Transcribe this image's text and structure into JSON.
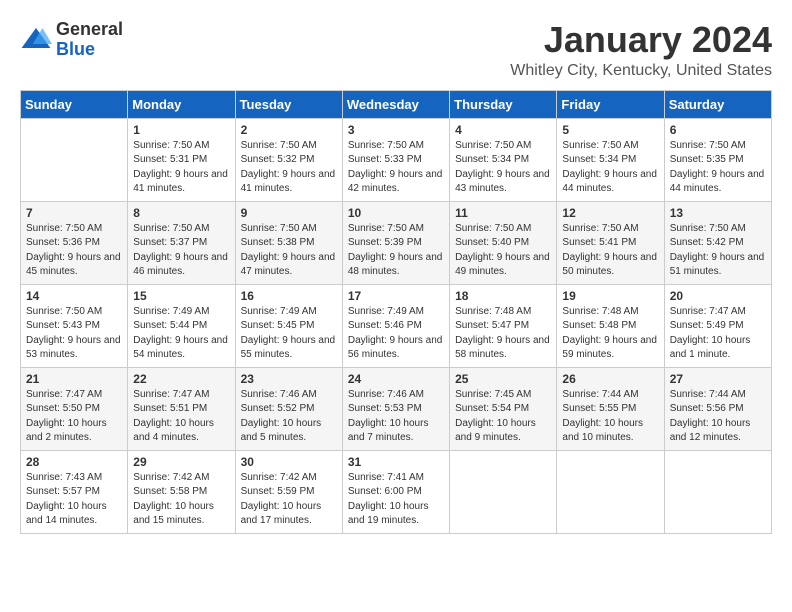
{
  "header": {
    "logo_line1": "General",
    "logo_line2": "Blue",
    "title": "January 2024",
    "subtitle": "Whitley City, Kentucky, United States"
  },
  "calendar": {
    "days_of_week": [
      "Sunday",
      "Monday",
      "Tuesday",
      "Wednesday",
      "Thursday",
      "Friday",
      "Saturday"
    ],
    "weeks": [
      [
        {
          "day": "",
          "sunrise": "",
          "sunset": "",
          "daylight": ""
        },
        {
          "day": "1",
          "sunrise": "Sunrise: 7:50 AM",
          "sunset": "Sunset: 5:31 PM",
          "daylight": "Daylight: 9 hours and 41 minutes."
        },
        {
          "day": "2",
          "sunrise": "Sunrise: 7:50 AM",
          "sunset": "Sunset: 5:32 PM",
          "daylight": "Daylight: 9 hours and 41 minutes."
        },
        {
          "day": "3",
          "sunrise": "Sunrise: 7:50 AM",
          "sunset": "Sunset: 5:33 PM",
          "daylight": "Daylight: 9 hours and 42 minutes."
        },
        {
          "day": "4",
          "sunrise": "Sunrise: 7:50 AM",
          "sunset": "Sunset: 5:34 PM",
          "daylight": "Daylight: 9 hours and 43 minutes."
        },
        {
          "day": "5",
          "sunrise": "Sunrise: 7:50 AM",
          "sunset": "Sunset: 5:34 PM",
          "daylight": "Daylight: 9 hours and 44 minutes."
        },
        {
          "day": "6",
          "sunrise": "Sunrise: 7:50 AM",
          "sunset": "Sunset: 5:35 PM",
          "daylight": "Daylight: 9 hours and 44 minutes."
        }
      ],
      [
        {
          "day": "7",
          "sunrise": "Sunrise: 7:50 AM",
          "sunset": "Sunset: 5:36 PM",
          "daylight": "Daylight: 9 hours and 45 minutes."
        },
        {
          "day": "8",
          "sunrise": "Sunrise: 7:50 AM",
          "sunset": "Sunset: 5:37 PM",
          "daylight": "Daylight: 9 hours and 46 minutes."
        },
        {
          "day": "9",
          "sunrise": "Sunrise: 7:50 AM",
          "sunset": "Sunset: 5:38 PM",
          "daylight": "Daylight: 9 hours and 47 minutes."
        },
        {
          "day": "10",
          "sunrise": "Sunrise: 7:50 AM",
          "sunset": "Sunset: 5:39 PM",
          "daylight": "Daylight: 9 hours and 48 minutes."
        },
        {
          "day": "11",
          "sunrise": "Sunrise: 7:50 AM",
          "sunset": "Sunset: 5:40 PM",
          "daylight": "Daylight: 9 hours and 49 minutes."
        },
        {
          "day": "12",
          "sunrise": "Sunrise: 7:50 AM",
          "sunset": "Sunset: 5:41 PM",
          "daylight": "Daylight: 9 hours and 50 minutes."
        },
        {
          "day": "13",
          "sunrise": "Sunrise: 7:50 AM",
          "sunset": "Sunset: 5:42 PM",
          "daylight": "Daylight: 9 hours and 51 minutes."
        }
      ],
      [
        {
          "day": "14",
          "sunrise": "Sunrise: 7:50 AM",
          "sunset": "Sunset: 5:43 PM",
          "daylight": "Daylight: 9 hours and 53 minutes."
        },
        {
          "day": "15",
          "sunrise": "Sunrise: 7:49 AM",
          "sunset": "Sunset: 5:44 PM",
          "daylight": "Daylight: 9 hours and 54 minutes."
        },
        {
          "day": "16",
          "sunrise": "Sunrise: 7:49 AM",
          "sunset": "Sunset: 5:45 PM",
          "daylight": "Daylight: 9 hours and 55 minutes."
        },
        {
          "day": "17",
          "sunrise": "Sunrise: 7:49 AM",
          "sunset": "Sunset: 5:46 PM",
          "daylight": "Daylight: 9 hours and 56 minutes."
        },
        {
          "day": "18",
          "sunrise": "Sunrise: 7:48 AM",
          "sunset": "Sunset: 5:47 PM",
          "daylight": "Daylight: 9 hours and 58 minutes."
        },
        {
          "day": "19",
          "sunrise": "Sunrise: 7:48 AM",
          "sunset": "Sunset: 5:48 PM",
          "daylight": "Daylight: 9 hours and 59 minutes."
        },
        {
          "day": "20",
          "sunrise": "Sunrise: 7:47 AM",
          "sunset": "Sunset: 5:49 PM",
          "daylight": "Daylight: 10 hours and 1 minute."
        }
      ],
      [
        {
          "day": "21",
          "sunrise": "Sunrise: 7:47 AM",
          "sunset": "Sunset: 5:50 PM",
          "daylight": "Daylight: 10 hours and 2 minutes."
        },
        {
          "day": "22",
          "sunrise": "Sunrise: 7:47 AM",
          "sunset": "Sunset: 5:51 PM",
          "daylight": "Daylight: 10 hours and 4 minutes."
        },
        {
          "day": "23",
          "sunrise": "Sunrise: 7:46 AM",
          "sunset": "Sunset: 5:52 PM",
          "daylight": "Daylight: 10 hours and 5 minutes."
        },
        {
          "day": "24",
          "sunrise": "Sunrise: 7:46 AM",
          "sunset": "Sunset: 5:53 PM",
          "daylight": "Daylight: 10 hours and 7 minutes."
        },
        {
          "day": "25",
          "sunrise": "Sunrise: 7:45 AM",
          "sunset": "Sunset: 5:54 PM",
          "daylight": "Daylight: 10 hours and 9 minutes."
        },
        {
          "day": "26",
          "sunrise": "Sunrise: 7:44 AM",
          "sunset": "Sunset: 5:55 PM",
          "daylight": "Daylight: 10 hours and 10 minutes."
        },
        {
          "day": "27",
          "sunrise": "Sunrise: 7:44 AM",
          "sunset": "Sunset: 5:56 PM",
          "daylight": "Daylight: 10 hours and 12 minutes."
        }
      ],
      [
        {
          "day": "28",
          "sunrise": "Sunrise: 7:43 AM",
          "sunset": "Sunset: 5:57 PM",
          "daylight": "Daylight: 10 hours and 14 minutes."
        },
        {
          "day": "29",
          "sunrise": "Sunrise: 7:42 AM",
          "sunset": "Sunset: 5:58 PM",
          "daylight": "Daylight: 10 hours and 15 minutes."
        },
        {
          "day": "30",
          "sunrise": "Sunrise: 7:42 AM",
          "sunset": "Sunset: 5:59 PM",
          "daylight": "Daylight: 10 hours and 17 minutes."
        },
        {
          "day": "31",
          "sunrise": "Sunrise: 7:41 AM",
          "sunset": "Sunset: 6:00 PM",
          "daylight": "Daylight: 10 hours and 19 minutes."
        },
        {
          "day": "",
          "sunrise": "",
          "sunset": "",
          "daylight": ""
        },
        {
          "day": "",
          "sunrise": "",
          "sunset": "",
          "daylight": ""
        },
        {
          "day": "",
          "sunrise": "",
          "sunset": "",
          "daylight": ""
        }
      ]
    ]
  }
}
